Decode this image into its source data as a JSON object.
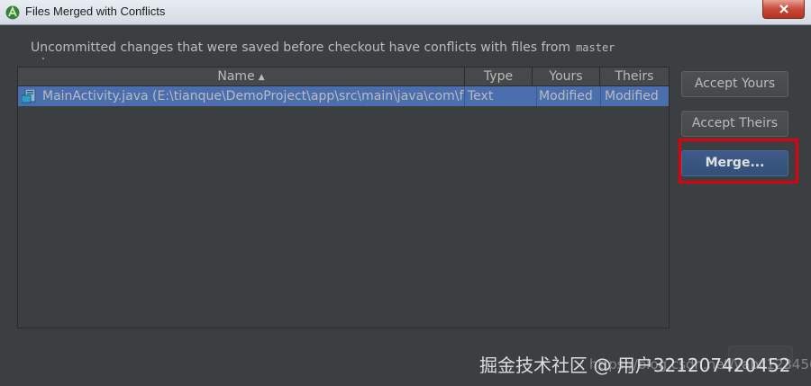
{
  "window": {
    "title": "Files Merged with Conflicts"
  },
  "message": {
    "text": "Uncommitted changes that were saved before checkout have conflicts with files from",
    "branch": "master"
  },
  "table": {
    "columns": [
      "Name",
      "Type",
      "Yours",
      "Theirs"
    ],
    "sort_indicator": "▲",
    "rows": [
      {
        "name": "MainActivity.java (E:\\tianque\\DemoProject\\app\\src\\main\\java\\com\\fly",
        "type": "Text",
        "yours": "Modified",
        "theirs": "Modified",
        "icon": "java-file-icon"
      }
    ]
  },
  "buttons": {
    "accept_yours": "Accept Yours",
    "accept_theirs": "Accept Theirs",
    "merge": "Merge..."
  },
  "watermark": {
    "text": "掘金技术社区 @ 用户321207420452",
    "url": "https://blog.csdn.net/yabc123456"
  },
  "colors": {
    "background": "#3c3f41",
    "selection": "#4b6eaf",
    "highlight": "#e0000d"
  }
}
